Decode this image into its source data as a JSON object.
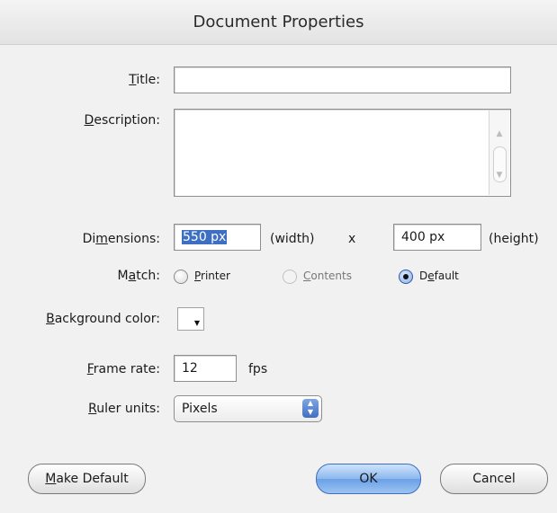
{
  "window": {
    "title": "Document Properties"
  },
  "form": {
    "title": {
      "label_u": "T",
      "label_rest": "itle:",
      "value": ""
    },
    "description": {
      "label_u": "D",
      "label_rest": "escription:",
      "value": ""
    },
    "dimensions": {
      "label_pre": "Di",
      "label_u": "m",
      "label_rest": "ensions:",
      "width_value": "550 px",
      "width_suffix": "(width)",
      "separator": "x",
      "height_value": "400 px",
      "height_suffix": "(height)"
    },
    "match": {
      "label_pre": "M",
      "label_u": "a",
      "label_rest": "tch:",
      "options": [
        {
          "u": "P",
          "rest": "rinter",
          "state": "unselected"
        },
        {
          "u": "C",
          "rest": "ontents",
          "state": "disabled"
        },
        {
          "pre": "D",
          "u": "e",
          "rest": "fault",
          "state": "selected"
        }
      ]
    },
    "background_color": {
      "label_u": "B",
      "label_rest": "ackground color:",
      "color": "#ffffff"
    },
    "frame_rate": {
      "label_u": "F",
      "label_rest": "rame rate:",
      "value": "12",
      "unit": "fps"
    },
    "ruler_units": {
      "label_u": "R",
      "label_rest": "uler units:",
      "selected": "Pixels"
    }
  },
  "buttons": {
    "make_default": {
      "u": "M",
      "rest": "ake Default"
    },
    "ok": "OK",
    "cancel": "Cancel"
  },
  "colors": {
    "accent": "#3e6fc2",
    "default_button": "#8cb8ee"
  }
}
